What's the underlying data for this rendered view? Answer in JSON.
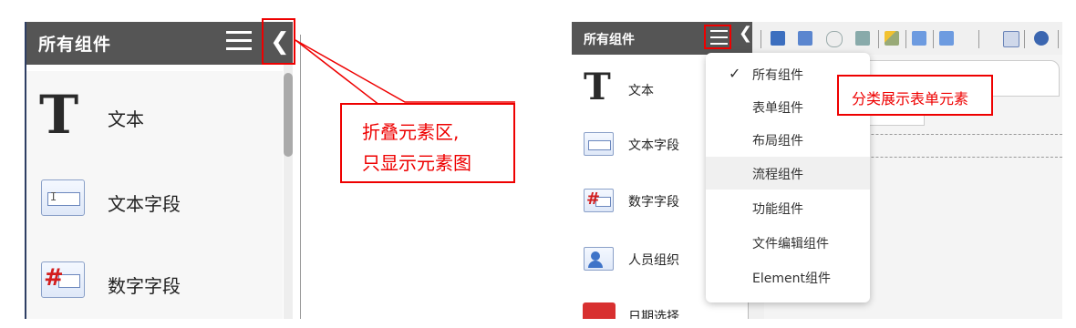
{
  "left_panel": {
    "title": "所有组件",
    "menu_icon": "hamburger-menu-icon",
    "collapse_icon": "chevron-left-icon",
    "items": [
      {
        "label": "文本",
        "icon": "text-T-icon"
      },
      {
        "label": "文本字段",
        "icon": "text-field-icon"
      },
      {
        "label": "数字字段",
        "icon": "number-field-icon"
      }
    ]
  },
  "annotations": {
    "collapse_note_line1": "折叠元素区,",
    "collapse_note_line2": "只显示元素图",
    "category_note": "分类展示表单元素",
    "color": "#e00000"
  },
  "right_panel": {
    "title": "所有组件",
    "items": [
      {
        "label": "文本",
        "icon": "text-T-icon"
      },
      {
        "label": "文本字段",
        "icon": "text-field-icon"
      },
      {
        "label": "数字字段",
        "icon": "number-field-icon"
      },
      {
        "label": "人员组织",
        "icon": "person-org-icon"
      },
      {
        "label": "日期选择",
        "icon": "calendar-icon"
      }
    ],
    "dropdown": {
      "selected_index": 0,
      "items": [
        "所有组件",
        "表单组件",
        "布局组件",
        "流程组件",
        "功能组件",
        "文件编辑组件",
        "Element组件"
      ]
    },
    "toolbar_icons": [
      "save-icon",
      "save-as-icon",
      "preview-icon",
      "print-icon",
      "wand-icon",
      "import-icon",
      "export-icon",
      "form-icon",
      "help-icon"
    ]
  },
  "colors": {
    "header_bg": "#555555",
    "accent_red": "#e00000"
  }
}
